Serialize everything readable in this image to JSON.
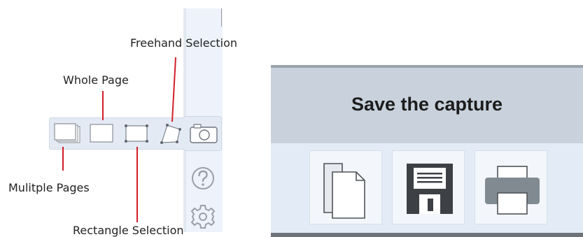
{
  "callouts": {
    "freehand": "Freehand Selection",
    "whole_page": "Whole Page",
    "multiple_pages": "Mulitple Pages",
    "rectangle": "Rectangle  Selection"
  },
  "toolbar": {
    "tools": [
      {
        "icon": "multiple-pages-icon"
      },
      {
        "icon": "whole-page-icon"
      },
      {
        "icon": "rectangle-selection-icon"
      },
      {
        "icon": "freehand-selection-icon"
      }
    ],
    "camera_icon": "camera-icon",
    "help_icon": "question-mark-icon",
    "settings_icon": "gear-icon"
  },
  "save_panel": {
    "title": "Save the capture",
    "actions": [
      {
        "icon": "copy-pages-icon"
      },
      {
        "icon": "floppy-disk-icon"
      },
      {
        "icon": "printer-icon"
      }
    ]
  },
  "colors": {
    "callout_line": "#d21f2a",
    "header_bg": "#c9d2dc",
    "panel_bg": "#e3ecf6"
  }
}
